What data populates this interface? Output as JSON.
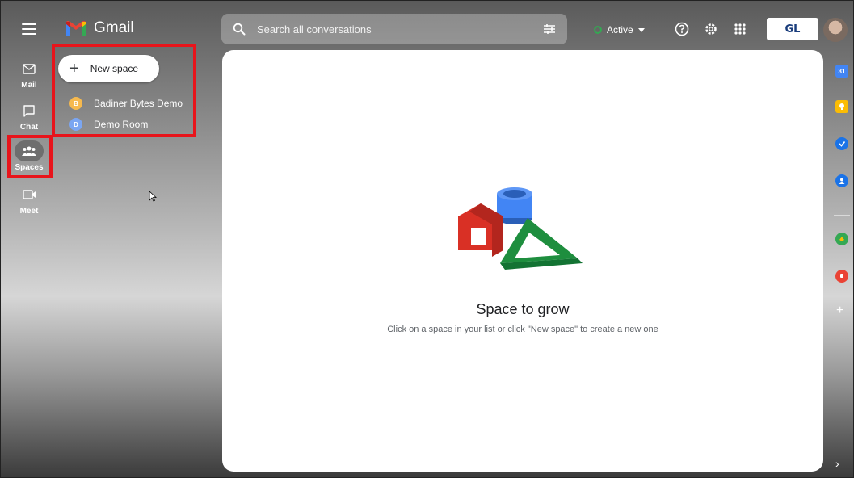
{
  "app": {
    "name": "Gmail"
  },
  "rail": {
    "items": [
      {
        "label": "Mail",
        "icon": "mail-icon"
      },
      {
        "label": "Chat",
        "icon": "chat-icon"
      },
      {
        "label": "Spaces",
        "icon": "spaces-icon",
        "active": true
      },
      {
        "label": "Meet",
        "icon": "meet-icon"
      }
    ]
  },
  "panel": {
    "new_space_label": "New space",
    "spaces": [
      {
        "name": "Badiner Bytes Demo",
        "initial": "B",
        "color": "#f6b94e"
      },
      {
        "name": "Demo Room",
        "initial": "D",
        "color": "#7ba6f2"
      }
    ]
  },
  "search": {
    "placeholder": "Search all conversations"
  },
  "status": {
    "label": "Active",
    "color": "#34a853"
  },
  "org_logo": {
    "text": "GL"
  },
  "main": {
    "title": "Space to grow",
    "subtitle": "Click on a space in your list or click \"New space\" to create a new one"
  },
  "rightbar": {
    "calendar_label": "31"
  },
  "colors": {
    "highlight": "#e8141b",
    "accent": "#1a73e8"
  }
}
